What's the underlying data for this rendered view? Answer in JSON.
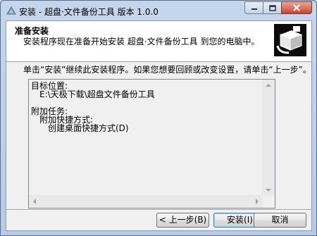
{
  "window": {
    "title": "安装 - 超盘·文件备份工具 版本 1.0.0"
  },
  "header": {
    "title": "准备安装",
    "subtitle": "安装程序现在准备开始安装 超盘·文件备份工具 到您的电脑中。"
  },
  "instruction": "单击“安装”继续此安装程序。如果您想要回顾或改变设置，请单击“上一步”。",
  "memo": {
    "dest_label": "目标位置:",
    "dest_value": "E:\\天极下载\\超盘文件备份工具",
    "tasks_label": "附加任务:",
    "tasks_group": "附加快捷方式:",
    "tasks_item": "创建桌面快捷方式(D)"
  },
  "buttons": {
    "back": "< 上一步(B)",
    "install": "安装(I)",
    "cancel": "取消"
  },
  "colors": {
    "titlebar": "#c5d6ec",
    "close_button": "#c8432d",
    "client_bg": "#f0f0f0",
    "default_button_border": "#3c7fb1"
  },
  "icons": [
    "app-icon",
    "minimize-icon",
    "maximize-icon",
    "close-icon",
    "installer-box-icon",
    "arrow-up-icon",
    "arrow-down-icon",
    "arrow-left-icon",
    "arrow-right-icon"
  ]
}
